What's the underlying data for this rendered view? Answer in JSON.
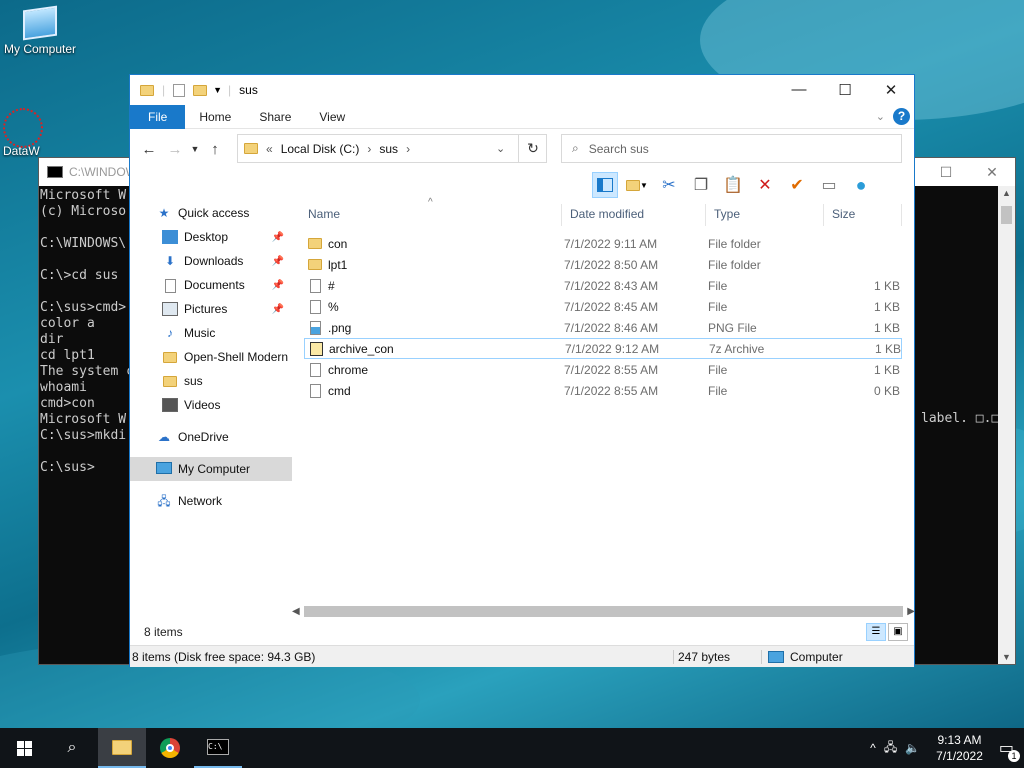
{
  "desktop": {
    "icons": [
      {
        "label": "My Computer"
      },
      {
        "label": "DataW"
      }
    ]
  },
  "cmd": {
    "title": "C:\\WINDOW",
    "lines": "Microsoft W\n(c) Microso\n\nC:\\WINDOWS\\:\n\nC:\\>cd sus\n\nC:\\sus>cmd>\ncolor a\ndir\ncd lpt1\nThe system c\nwhoami\ncmd>con\nMicrosoft W\nC:\\sus>mkdi\n\nC:\\sus>",
    "right_text": "label. □.□"
  },
  "explorer": {
    "title": "sus",
    "ribbon_tabs": [
      "File",
      "Home",
      "Share",
      "View"
    ],
    "address": {
      "prefix": "«",
      "drive": "Local Disk (C:)",
      "folder": "sus"
    },
    "search_placeholder": "Search sus",
    "nav": {
      "quick_access": "Quick access",
      "pinned": [
        "Desktop",
        "Downloads",
        "Documents",
        "Pictures"
      ],
      "others": [
        "Music",
        "Open-Shell Modern",
        "sus",
        "Videos"
      ],
      "onedrive": "OneDrive",
      "my_computer": "My Computer",
      "network": "Network"
    },
    "columns": {
      "name": "Name",
      "date": "Date modified",
      "type": "Type",
      "size": "Size"
    },
    "files": [
      {
        "name": "con",
        "date": "7/1/2022 9:11 AM",
        "type": "File folder",
        "size": "",
        "icon": "folder-icon"
      },
      {
        "name": "lpt1",
        "date": "7/1/2022 8:50 AM",
        "type": "File folder",
        "size": "",
        "icon": "folder-icon"
      },
      {
        "name": "#",
        "date": "7/1/2022 8:43 AM",
        "type": "File",
        "size": "1 KB",
        "icon": "file-icon"
      },
      {
        "name": "%",
        "date": "7/1/2022 8:45 AM",
        "type": "File",
        "size": "1 KB",
        "icon": "file-icon"
      },
      {
        "name": ".png",
        "date": "7/1/2022 8:46 AM",
        "type": "PNG File",
        "size": "1 KB",
        "icon": "image-file-icon"
      },
      {
        "name": "archive_con",
        "date": "7/1/2022 9:12 AM",
        "type": "7z Archive",
        "size": "1 KB",
        "icon": "archive-icon"
      },
      {
        "name": "chrome",
        "date": "7/1/2022 8:55 AM",
        "type": "File",
        "size": "1 KB",
        "icon": "file-icon"
      },
      {
        "name": "cmd",
        "date": "7/1/2022 8:55 AM",
        "type": "File",
        "size": "0 KB",
        "icon": "file-icon"
      }
    ],
    "item_count": "8 items",
    "status": {
      "summary": "8 items (Disk free space: 94.3 GB)",
      "size": "247 bytes",
      "location": "Computer"
    }
  },
  "taskbar": {
    "time": "9:13 AM",
    "date": "7/1/2022",
    "notification_count": "1"
  }
}
